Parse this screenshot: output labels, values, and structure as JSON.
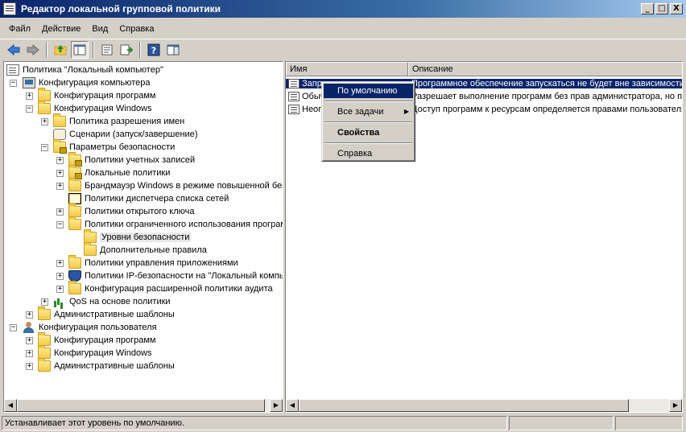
{
  "window": {
    "title": "Редактор локальной групповой политики",
    "buttons": {
      "minimize": "_",
      "maximize": "□",
      "close": "X"
    }
  },
  "menubar": {
    "items": [
      "Файл",
      "Действие",
      "Вид",
      "Справка"
    ]
  },
  "tree": {
    "items": [
      {
        "label": "Политика \"Локальный компьютер\"",
        "icon": "document-icon"
      },
      {
        "label": "Конфигурация компьютера",
        "icon": "computer-icon",
        "expander": "−"
      },
      {
        "label": "Конфигурация программ",
        "icon": "folder-icon",
        "expander": "+"
      },
      {
        "label": "Конфигурация Windows",
        "icon": "folder-icon",
        "expander": "−"
      },
      {
        "label": "Политика разрешения имен",
        "icon": "folder-icon",
        "expander": "+"
      },
      {
        "label": "Сценарии (запуск/завершение)",
        "icon": "scroll-icon"
      },
      {
        "label": "Параметры безопасности",
        "icon": "lock-folder-icon",
        "expander": "−"
      },
      {
        "label": "Политики учетных записей",
        "icon": "lock-folder-icon",
        "expander": "+"
      },
      {
        "label": "Локальные политики",
        "icon": "lock-folder-icon",
        "expander": "+"
      },
      {
        "label": "Брандмауэр Windows в режиме повышенной безопасности",
        "icon": "folder-icon",
        "expander": "+"
      },
      {
        "label": "Политики диспетчера списка сетей",
        "icon": "folder-icon"
      },
      {
        "label": "Политики открытого ключа",
        "icon": "folder-icon",
        "expander": "+"
      },
      {
        "label": "Политики ограниченного использования программ",
        "icon": "folder-icon",
        "expander": "−"
      },
      {
        "label": "Уровни безопасности",
        "icon": "folder-icon"
      },
      {
        "label": "Дополнительные правила",
        "icon": "folder-icon"
      },
      {
        "label": "Политики управления приложениями",
        "icon": "folder-icon",
        "expander": "+"
      },
      {
        "label": "Политики IP-безопасности на \"Локальный компьютер\"",
        "icon": "shield-icon",
        "expander": "+"
      },
      {
        "label": "Конфигурация расширенной политики аудита",
        "icon": "folder-icon",
        "expander": "+"
      },
      {
        "label": "QoS на основе политики",
        "icon": "chart-icon",
        "expander": "+"
      },
      {
        "label": "Административные шаблоны",
        "icon": "folder-icon",
        "expander": "+"
      },
      {
        "label": "Конфигурация пользователя",
        "icon": "user-icon",
        "expander": "−"
      },
      {
        "label": "Конфигурация программ",
        "icon": "folder-icon",
        "expander": "+"
      },
      {
        "label": "Конфигурация Windows",
        "icon": "folder-icon",
        "expander": "+"
      },
      {
        "label": "Административные шаблоны",
        "icon": "folder-icon",
        "expander": "+"
      }
    ]
  },
  "list": {
    "columns": [
      "Имя",
      "Описание"
    ],
    "rows": [
      {
        "name": "Запре",
        "desc": "Программное обеспечение запускаться не будет вне зависимости от прав доступа пользователя."
      },
      {
        "name": "Обыч",
        "desc": "Разрешает выполнение программ без прав администратора, но позволяет им получать доступ к ресурсам, доступным для обычных пользователей."
      },
      {
        "name": "Неогр",
        "desc": "Доступ программ к ресурсам определяется правами пользователя."
      }
    ]
  },
  "context_menu": {
    "items": {
      "default": "По умолчанию",
      "all_tasks": "Все задачи",
      "properties": "Свойства",
      "help": "Справка"
    },
    "submenu_arrow": "▶"
  },
  "statusbar": {
    "text": "Устанавливает этот уровень по умолчанию."
  },
  "scroll": {
    "left_arrow": "◀",
    "right_arrow": "▶"
  },
  "colors": {
    "selection": "#0a246a",
    "title_gradient_start": "#0a246a",
    "window_bg": "#d4d0c8"
  }
}
